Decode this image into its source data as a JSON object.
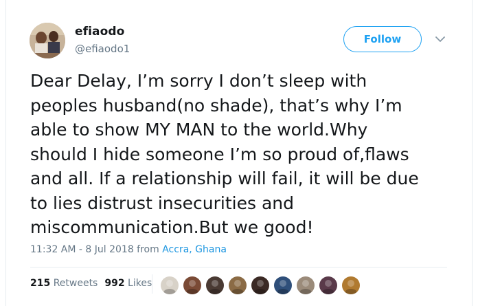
{
  "author": {
    "display_name": "efiaodo",
    "handle": "@efiaodo1",
    "avatar_icon": "profile-photo"
  },
  "follow_button": {
    "label": "Follow",
    "color": "#1da1f2"
  },
  "menu_icon": "chevron-down-icon",
  "tweet": {
    "lines": [
      "Dear Delay, I’m sorry I don’t sleep with",
      "peoples husband(no shade), that’s why I’m",
      "able to show MY MAN to the world.Why",
      "should I hide someone I’m so proud of,flaws",
      "and all. If a relationship will fail, it will be due",
      "to lies distrust insecurities and",
      "miscommunication.But we good!"
    ]
  },
  "meta": {
    "timestamp": "11:32 AM - 8 Jul 2018 from ",
    "location": "Accra, Ghana"
  },
  "stats": {
    "retweets_count": "215",
    "retweets_label": "Retweets",
    "likes_count": "992",
    "likes_label": "Likes"
  },
  "likers": [
    {
      "name": "liker-avatar-1",
      "color": "#d8d2c8"
    },
    {
      "name": "liker-avatar-2",
      "color": "#7a4a35"
    },
    {
      "name": "liker-avatar-3",
      "color": "#4a3a33"
    },
    {
      "name": "liker-avatar-4",
      "color": "#8b6b45"
    },
    {
      "name": "liker-avatar-5",
      "color": "#3b2a25"
    },
    {
      "name": "liker-avatar-6",
      "color": "#2f4f7a"
    },
    {
      "name": "liker-avatar-7",
      "color": "#9b8b7a"
    },
    {
      "name": "liker-avatar-8",
      "color": "#5a3a4a"
    },
    {
      "name": "liker-avatar-9",
      "color": "#b07a30"
    }
  ]
}
